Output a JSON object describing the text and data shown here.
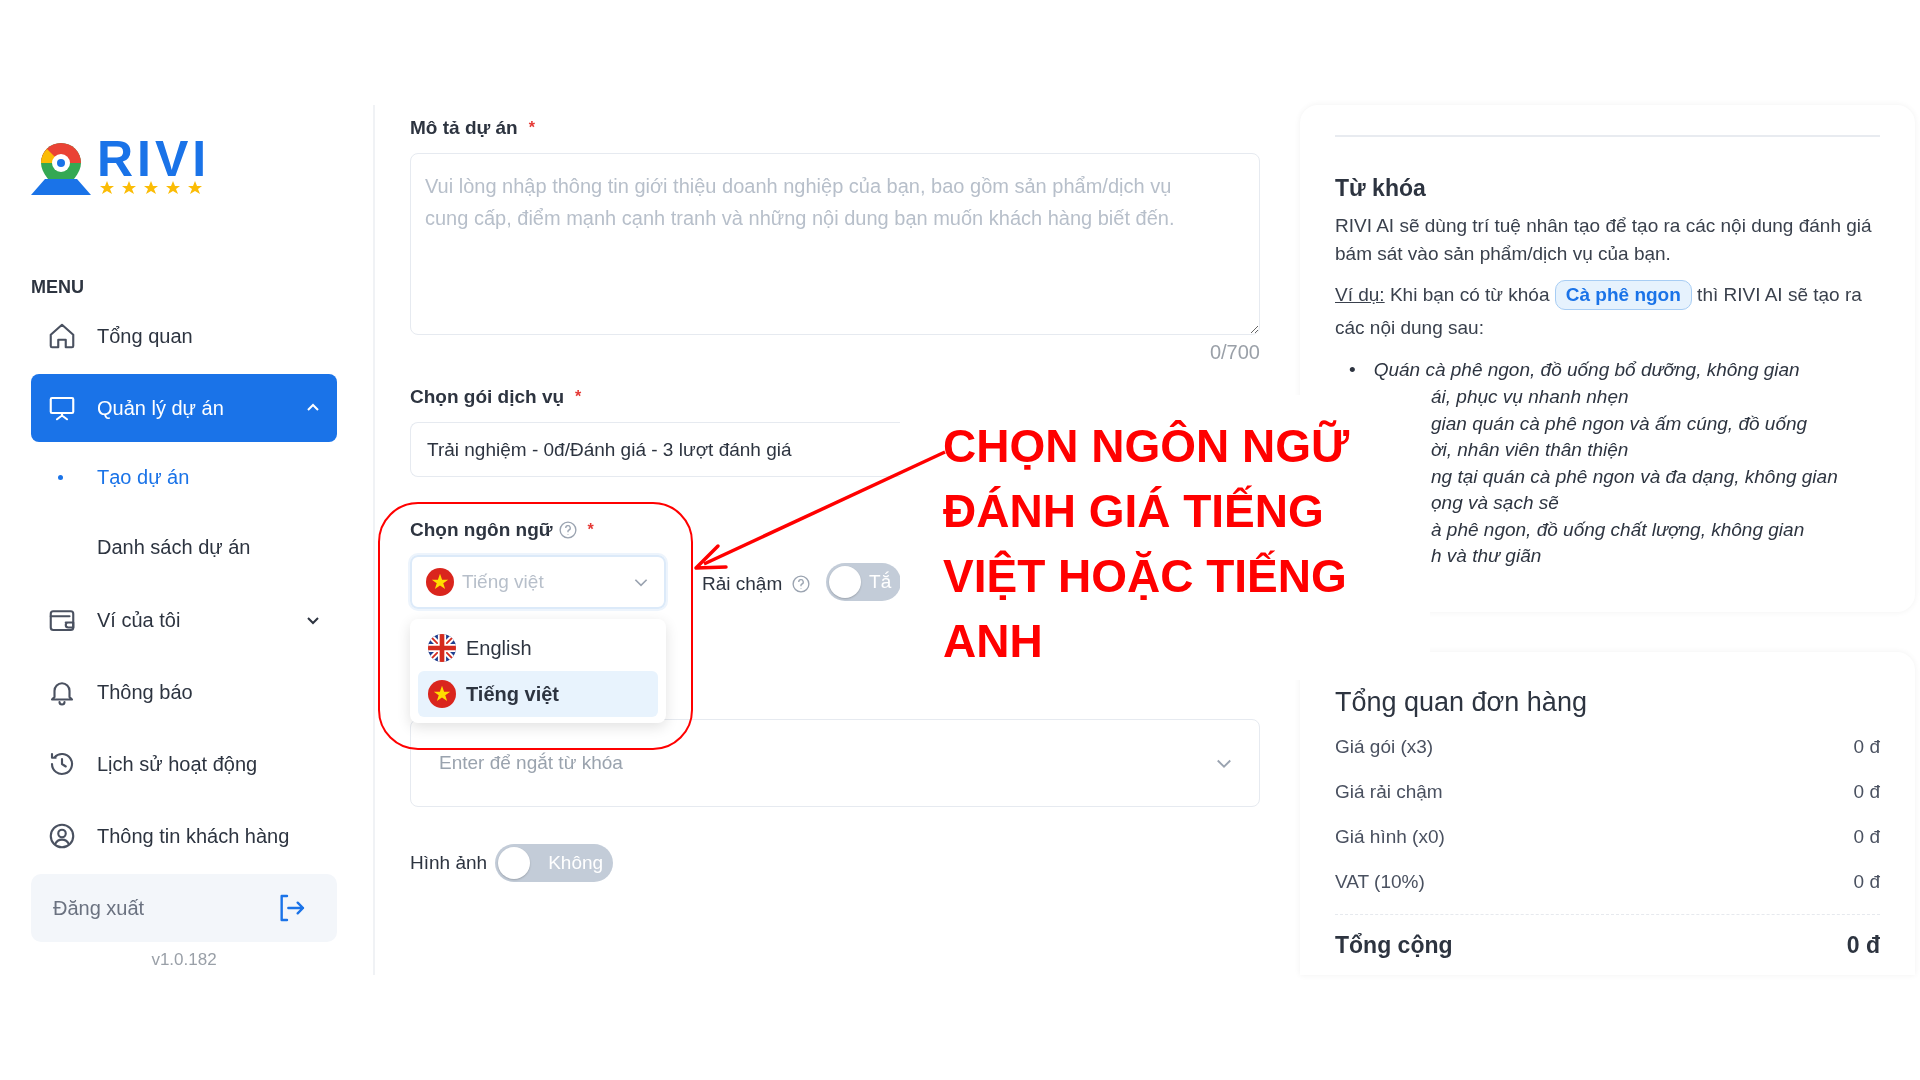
{
  "logo": {
    "text": "RIVI"
  },
  "sidebar": {
    "heading": "MENU",
    "items": [
      {
        "label": "Tổng quan",
        "kind": "home",
        "selected": false
      },
      {
        "label": "Quản lý dự án",
        "kind": "board",
        "selected": true,
        "expanded": true,
        "children": [
          {
            "label": "Tạo dự án",
            "selected": true
          },
          {
            "label": "Danh sách dự án",
            "selected": false
          }
        ]
      },
      {
        "label": "Ví của tôi",
        "kind": "wallet",
        "selected": false,
        "expanded": false
      },
      {
        "label": "Thông báo",
        "kind": "bell",
        "selected": false
      },
      {
        "label": "Lịch sử hoạt động",
        "kind": "history",
        "selected": false
      },
      {
        "label": "Thông tin khách hàng",
        "kind": "user",
        "selected": false
      }
    ],
    "logout": "Đăng xuất",
    "version": "v1.0.182"
  },
  "form": {
    "description": {
      "label": "Mô tả dự án",
      "required_mark": "*",
      "placeholder": "Vui lòng nhập thông tin giới thiệu doanh nghiệp của bạn, bao gồm sản phẩm/dịch vụ cung cấp, điểm mạnh cạnh tranh và những nội dung bạn muốn khách hàng biết đến.",
      "counter": "0/700"
    },
    "package": {
      "label": "Chọn gói dịch vụ",
      "required_mark": "*",
      "value": "Trải nghiệm - 0đ/Đánh giá - 3 lượt đánh giá"
    },
    "language": {
      "label": "Chọn ngôn ngữ",
      "required_mark": "*",
      "placeholder": "Tiếng việt",
      "options": [
        {
          "label": "English",
          "kind": "uk",
          "selected": false
        },
        {
          "label": "Tiếng việt",
          "kind": "vn",
          "selected": true
        }
      ]
    },
    "slow": {
      "label": "Rải chậm",
      "toggle_text": "Tắ",
      "on": false
    },
    "keywords": {
      "placeholder": "Enter để ngắt từ khóa"
    },
    "images": {
      "label": "Hình ảnh",
      "toggle_text": "Không",
      "on": false
    }
  },
  "keyword_help": {
    "title": "Từ khóa",
    "intro": "RIVI AI sẽ dùng trí tuệ nhân tạo để tạo ra các nội dung đánh giá bám sát vào sản phẩm/dịch vụ của bạn.",
    "example_label": "Ví dụ:",
    "example_before": "Khi bạn có từ khóa",
    "example_keyword": "Cà phê ngon",
    "example_after": "thì RIVI AI sẽ tạo ra các nội dung sau:",
    "examples": [
      {
        "bullet": "•",
        "text": "Quán cà phê ngon, đồ uống bổ dưỡng, không gian"
      }
    ],
    "example_fragments": [
      "ái, phục vụ nhanh nhẹn",
      "gian quán cà phê ngon và ấm cúng, đồ uống",
      "ời, nhân viên thân thiện",
      "ng tại quán cà phê ngon và đa dạng, không gian",
      "ọng và sạch sẽ",
      "à phê ngon, đồ uống chất lượng, không gian",
      "h và thư giãn"
    ]
  },
  "order_summary": {
    "title": "Tổng quan đơn hàng",
    "rows": [
      {
        "label": "Giá gói (x3)",
        "value": "0 đ"
      },
      {
        "label": "Giá rải chậm",
        "value": "0 đ"
      },
      {
        "label": "Giá hình (x0)",
        "value": "0 đ"
      },
      {
        "label": "VAT (10%)",
        "value": "0 đ"
      }
    ],
    "total_label": "Tổng cộng",
    "total_value": "0 đ"
  },
  "annotation": {
    "lines": [
      "CHỌN NGÔN NGỮ",
      "ĐÁNH GIÁ TIẾNG",
      "VIỆT HOẶC TIẾNG",
      "ANH"
    ]
  }
}
